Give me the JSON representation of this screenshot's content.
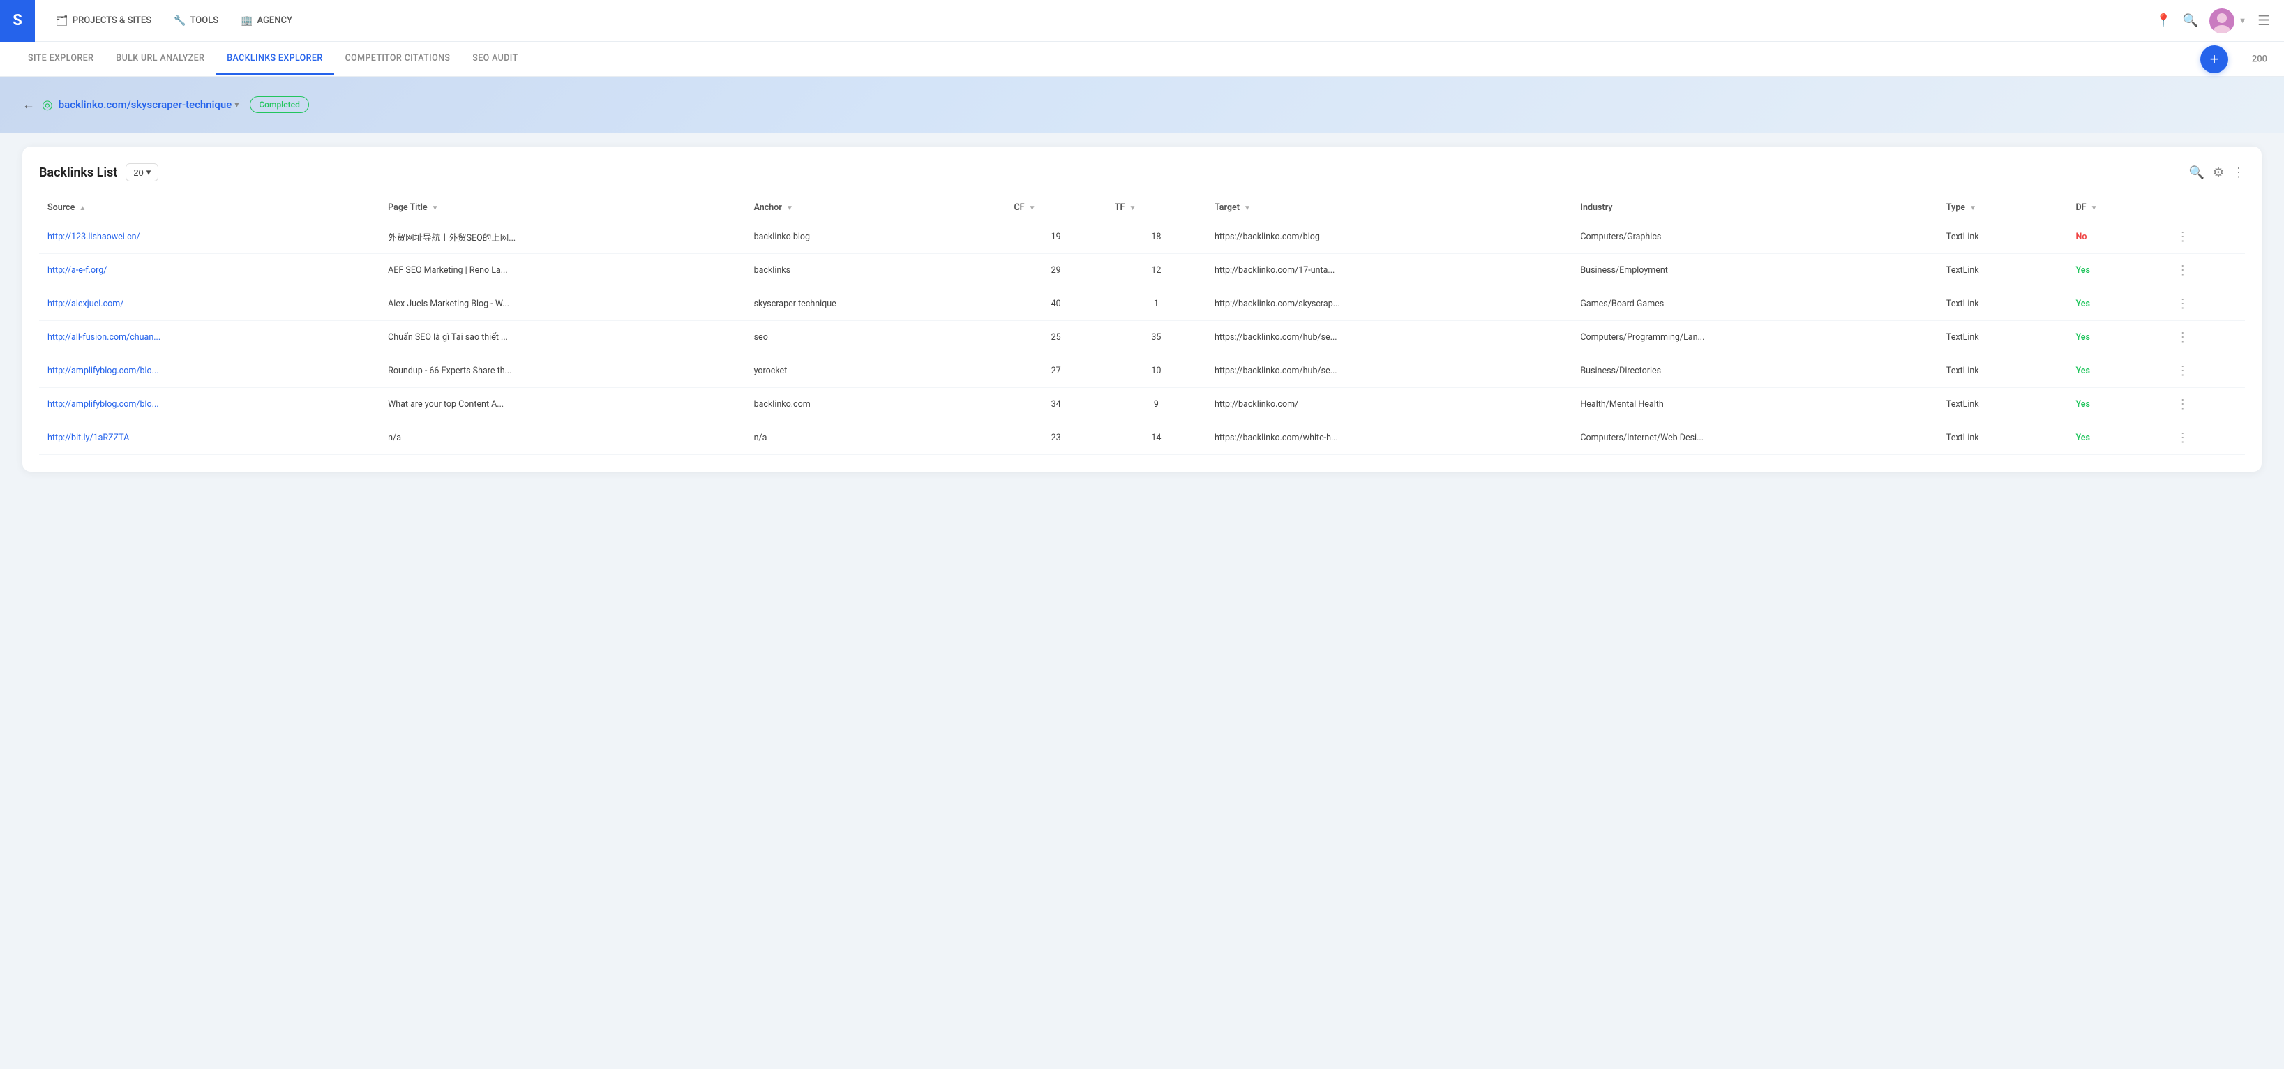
{
  "app": {
    "logo": "S",
    "logo_bg": "#2563eb"
  },
  "top_nav": {
    "items": [
      {
        "id": "projects",
        "icon": "🗂",
        "label": "PROJECTS & SITES"
      },
      {
        "id": "tools",
        "icon": "🔧",
        "label": "TOOLS"
      },
      {
        "id": "agency",
        "icon": "🏢",
        "label": "AGENCY"
      }
    ]
  },
  "sub_nav": {
    "tabs": [
      {
        "id": "site-explorer",
        "label": "SITE EXPLORER",
        "active": false
      },
      {
        "id": "bulk-url-analyzer",
        "label": "BULK URL ANALYZER",
        "active": false
      },
      {
        "id": "backlinks-explorer",
        "label": "BACKLINKS EXPLORER",
        "active": true
      },
      {
        "id": "competitor-citations",
        "label": "COMPETITOR CITATIONS",
        "active": false
      },
      {
        "id": "seo-audit",
        "label": "SEO AUDIT",
        "active": false
      }
    ],
    "add_label": "+",
    "credits": "200"
  },
  "hero": {
    "site_url": "backlinko.com/skyscraper-technique",
    "status": "Completed"
  },
  "table": {
    "title": "Backlinks List",
    "per_page": "20",
    "columns": [
      {
        "id": "source",
        "label": "Source",
        "sort": "asc"
      },
      {
        "id": "page_title",
        "label": "Page Title",
        "sort": "desc"
      },
      {
        "id": "anchor",
        "label": "Anchor",
        "sort": "desc"
      },
      {
        "id": "cf",
        "label": "CF",
        "sort": "desc"
      },
      {
        "id": "tf",
        "label": "TF",
        "sort": "desc"
      },
      {
        "id": "target",
        "label": "Target",
        "sort": "desc"
      },
      {
        "id": "industry",
        "label": "Industry",
        "sort": "none"
      },
      {
        "id": "type",
        "label": "Type",
        "sort": "desc"
      },
      {
        "id": "df",
        "label": "DF",
        "sort": "desc"
      }
    ],
    "rows": [
      {
        "source": "http://123.lishaowei.cn/",
        "page_title": "外贸网址导航丨外贸SEO的上网...",
        "anchor": "backlinko blog",
        "cf": "19",
        "tf": "18",
        "target": "https://backlinko.com/blog",
        "industry": "Computers/Graphics",
        "type": "TextLink",
        "df": "No",
        "df_class": "df-no"
      },
      {
        "source": "http://a-e-f.org/",
        "page_title": "AEF SEO Marketing | Reno La...",
        "anchor": "backlinks",
        "cf": "29",
        "tf": "12",
        "target": "http://backlinko.com/17-unta...",
        "industry": "Business/Employment",
        "type": "TextLink",
        "df": "Yes",
        "df_class": "df-yes"
      },
      {
        "source": "http://alexjuel.com/",
        "page_title": "Alex Juels Marketing Blog - W...",
        "anchor": "skyscraper technique",
        "cf": "40",
        "tf": "1",
        "target": "http://backlinko.com/skyscrap...",
        "industry": "Games/Board Games",
        "type": "TextLink",
        "df": "Yes",
        "df_class": "df-yes"
      },
      {
        "source": "http://all-fusion.com/chuan...",
        "page_title": "Chuẩn SEO là gì Tại sao thiết ...",
        "anchor": "seo",
        "cf": "25",
        "tf": "35",
        "target": "https://backlinko.com/hub/se...",
        "industry": "Computers/Programming/Lan...",
        "type": "TextLink",
        "df": "Yes",
        "df_class": "df-yes"
      },
      {
        "source": "http://amplifyblog.com/blo...",
        "page_title": "Roundup - 66 Experts Share th...",
        "anchor": "yorocket",
        "cf": "27",
        "tf": "10",
        "target": "https://backlinko.com/hub/se...",
        "industry": "Business/Directories",
        "type": "TextLink",
        "df": "Yes",
        "df_class": "df-yes"
      },
      {
        "source": "http://amplifyblog.com/blo...",
        "page_title": "What are your top Content A...",
        "anchor": "backlinko.com",
        "cf": "34",
        "tf": "9",
        "target": "http://backlinko.com/",
        "industry": "Health/Mental Health",
        "type": "TextLink",
        "df": "Yes",
        "df_class": "df-yes"
      },
      {
        "source": "http://bit.ly/1aRZZTA",
        "page_title": "n/a",
        "anchor": "n/a",
        "cf": "23",
        "tf": "14",
        "target": "https://backlinko.com/white-h...",
        "industry": "Computers/Internet/Web Desi...",
        "type": "TextLink",
        "df": "Yes",
        "df_class": "df-yes"
      }
    ]
  }
}
